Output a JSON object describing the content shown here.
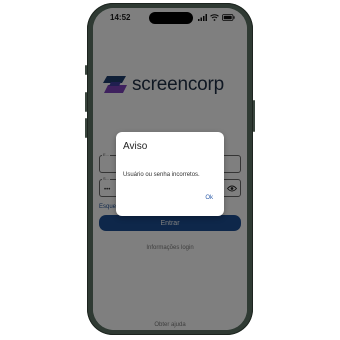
{
  "status_bar": {
    "time": "14:52",
    "icons": [
      "signal-icon",
      "wifi-icon",
      "battery-icon"
    ]
  },
  "brand": {
    "name": "screencorp",
    "logo_icon": "screencorp-logo-icon",
    "colors": {
      "purple": "#7d43bd",
      "dark": "#1e2e45",
      "blue": "#1c4f95"
    }
  },
  "login_form": {
    "user_field": {
      "label": "E...",
      "value": ""
    },
    "password_field": {
      "label": "S...",
      "value": "•••",
      "toggle_icon": "eye-icon"
    },
    "forgot_link": "Esque...",
    "enter_button": "Entrar",
    "info_link": "Informações login",
    "help_link": "Obter ajuda"
  },
  "dialog": {
    "title": "Aviso",
    "message": "Usuário ou senha incorretos.",
    "ok_button": "Ok"
  }
}
